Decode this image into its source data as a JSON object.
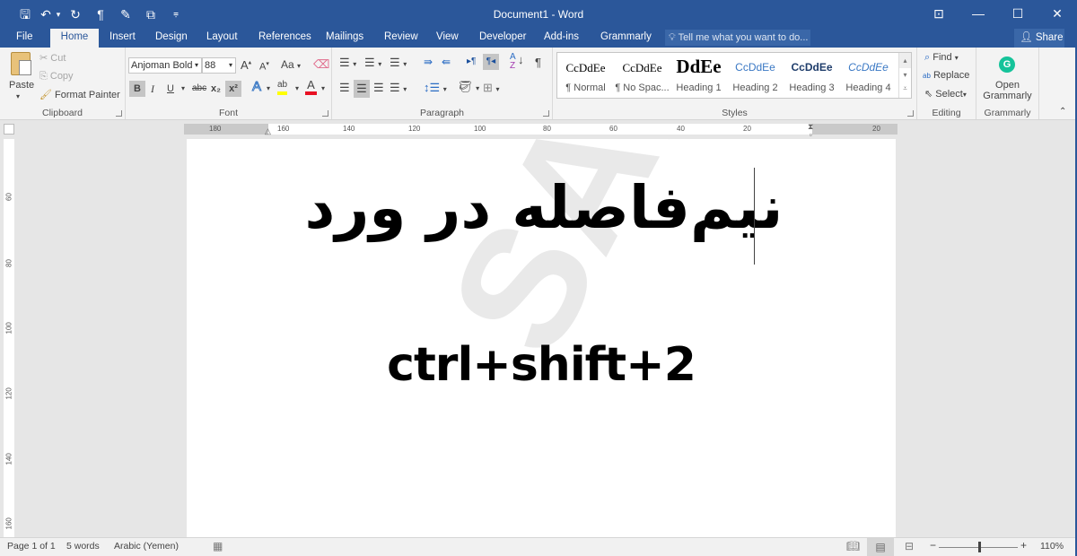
{
  "titlebar": {
    "title": "Document1 - Word",
    "qat": [
      {
        "name": "save-icon",
        "glyph": "🖫"
      },
      {
        "name": "undo-icon",
        "glyph": "↶"
      },
      {
        "name": "undo-dropdown-icon",
        "glyph": "▾"
      },
      {
        "name": "redo-icon",
        "glyph": "↻"
      },
      {
        "name": "pilcrow-icon",
        "glyph": "¶"
      },
      {
        "name": "format-painter-icon",
        "glyph": "✎"
      },
      {
        "name": "touch-mode-icon",
        "glyph": "⧉"
      },
      {
        "name": "customize-qat-icon",
        "glyph": "⩦"
      }
    ],
    "window_controls": {
      "ribbon_options": "⊡",
      "minimize": "—",
      "maximize": "☐",
      "close": "✕"
    }
  },
  "tabs": [
    {
      "label": "File",
      "active": false
    },
    {
      "label": "Home",
      "active": true
    },
    {
      "label": "Insert",
      "active": false
    },
    {
      "label": "Design",
      "active": false
    },
    {
      "label": "Layout",
      "active": false
    },
    {
      "label": "References",
      "active": false
    },
    {
      "label": "Mailings",
      "active": false
    },
    {
      "label": "Review",
      "active": false
    },
    {
      "label": "View",
      "active": false
    },
    {
      "label": "Developer",
      "active": false
    },
    {
      "label": "Add-ins",
      "active": false
    },
    {
      "label": "Grammarly",
      "active": false
    }
  ],
  "tell_me": {
    "icon": "lightbulb-icon",
    "placeholder": "Tell me what you want to do..."
  },
  "share": {
    "label": "Share"
  },
  "ribbon": {
    "clipboard": {
      "label": "Clipboard",
      "paste": "Paste",
      "cut": "Cut",
      "copy": "Copy",
      "format_painter": "Format Painter"
    },
    "font": {
      "label": "Font",
      "font_name": "Anjoman Bold",
      "font_size": "88",
      "grow": "A",
      "shrink": "A",
      "change_case": "Aa",
      "bold": "B",
      "italic": "I",
      "underline": "U",
      "strikethrough": "abc",
      "subscript": "x₂",
      "superscript": "x²",
      "text_effects": "A",
      "highlight": "ab",
      "font_color": "A",
      "bold_active": true,
      "superscript_active": true
    },
    "paragraph": {
      "label": "Paragraph",
      "rtl_active": true,
      "align_center_active": true
    },
    "styles": {
      "label": "Styles",
      "items": [
        {
          "preview": "CcDdEe",
          "name": "¶ Normal"
        },
        {
          "preview": "CcDdEe",
          "name": "¶ No Spac..."
        },
        {
          "preview": "DdEe",
          "name": "Heading 1"
        },
        {
          "preview": "CcDdEe",
          "name": "Heading 2"
        },
        {
          "preview": "CcDdEe",
          "name": "Heading 3"
        },
        {
          "preview": "CcDdEe",
          "name": "Heading 4"
        }
      ]
    },
    "editing": {
      "label": "Editing",
      "find": "Find",
      "replace": "Replace",
      "select": "Select"
    },
    "grammarly": {
      "label": "Grammarly",
      "open_line1": "Open",
      "open_line2": "Grammarly",
      "accent": "#15c39a"
    }
  },
  "ruler": {
    "horizontal_labels": [
      "180",
      "160",
      "140",
      "120",
      "100",
      "80",
      "60",
      "40",
      "20",
      "20"
    ],
    "vertical_labels": [
      "60",
      "80",
      "100",
      "120",
      "140",
      "160"
    ]
  },
  "document": {
    "line1": "نیم‌فاصله در ورد",
    "line2": "ctrl+shift+2",
    "watermark": "SAMPLE"
  },
  "statusbar": {
    "page": "Page 1 of 1",
    "words": "5 words",
    "language": "Arabic (Yemen)",
    "zoom_out": "−",
    "zoom_in": "+",
    "zoom": "110%",
    "zoom_percent": 110
  },
  "colors": {
    "brand": "#2b579a",
    "highlight_yellow": "#ffff00",
    "font_red": "#e81123"
  }
}
